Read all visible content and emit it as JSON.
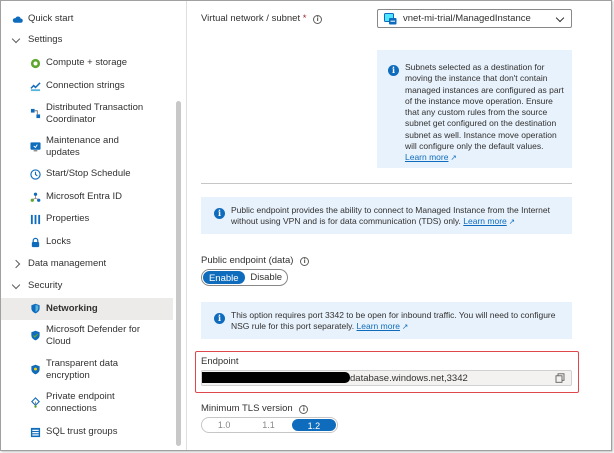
{
  "sidebar": {
    "items": [
      {
        "label": "Quick start",
        "icon": "cloud-icon"
      },
      {
        "label": "Settings",
        "expanded": true
      },
      {
        "label": "Compute + storage",
        "icon": "compute-storage-icon"
      },
      {
        "label": "Connection strings",
        "icon": "connection-strings-icon"
      },
      {
        "label": "Distributed Transaction Coordinator",
        "line1": "Distributed Transaction",
        "line2": "Coordinator",
        "icon": "dtc-icon"
      },
      {
        "label": "Maintenance and updates",
        "line1": "Maintenance and",
        "line2": "updates",
        "icon": "maintenance-icon"
      },
      {
        "label": "Start/Stop Schedule",
        "icon": "clock-icon"
      },
      {
        "label": "Microsoft Entra ID",
        "icon": "entra-id-icon"
      },
      {
        "label": "Properties",
        "icon": "properties-icon"
      },
      {
        "label": "Locks",
        "icon": "lock-icon"
      },
      {
        "label": "Data management",
        "expanded": false
      },
      {
        "label": "Security",
        "expanded": true
      },
      {
        "label": "Networking",
        "icon": "shield-icon",
        "selected": true
      },
      {
        "label": "Microsoft Defender for Cloud",
        "line1": "Microsoft Defender for",
        "line2": "Cloud",
        "icon": "defender-icon"
      },
      {
        "label": "Transparent data encryption",
        "line1": "Transparent data",
        "line2": "encryption",
        "icon": "encryption-shield-icon"
      },
      {
        "label": "Private endpoint connections",
        "line1": "Private endpoint",
        "line2": "connections",
        "icon": "private-endpoint-icon"
      },
      {
        "label": "SQL trust groups",
        "icon": "trust-groups-icon"
      }
    ]
  },
  "vnet": {
    "label": "Virtual network / subnet",
    "required": "*",
    "value": "vnet-mi-trial/ManagedInstance",
    "info": "Subnets selected as a destination for moving the instance that don't contain managed instances are configured as part of the instance move operation. Ensure that any custom rules from the source subnet get configured on the destination subnet as well. Instance move operation will configure only the default values.",
    "info_lines": [
      "Subnets selected as a destination for",
      "moving the instance that don't contain",
      "managed instances are configured as part",
      "of the instance move operation. Ensure",
      "that any custom rules from the source",
      "subnet get configured on the destination",
      "subnet as well. Instance move operation",
      "will configure only the default values."
    ],
    "learn_more": "Learn more"
  },
  "public_endpoint_info": {
    "line1": "Public endpoint provides the ability to connect to Managed Instance from the Internet",
    "line2": "without using VPN and is for data communication (TDS) only.",
    "learn_more": "Learn more"
  },
  "public_endpoint": {
    "label": "Public endpoint (data)",
    "options": [
      "Enable",
      "Disable"
    ],
    "selected": "Enable"
  },
  "port_info": {
    "line1": "This option requires port 3342 to be open for inbound traffic. You will need to configure",
    "line2": "NSG rule for this port separately.",
    "learn_more": "Learn more"
  },
  "endpoint": {
    "label": "Endpoint",
    "value": "database.windows.net,3342"
  },
  "tls": {
    "label": "Minimum TLS version",
    "options": [
      "1.0",
      "1.1",
      "1.2"
    ],
    "selected": "1.2"
  },
  "colors": {
    "accent": "#0f6cbd",
    "info_bg": "#e8f2fc",
    "highlight_border": "#e0474c",
    "selected_bg": "#edebe9"
  }
}
